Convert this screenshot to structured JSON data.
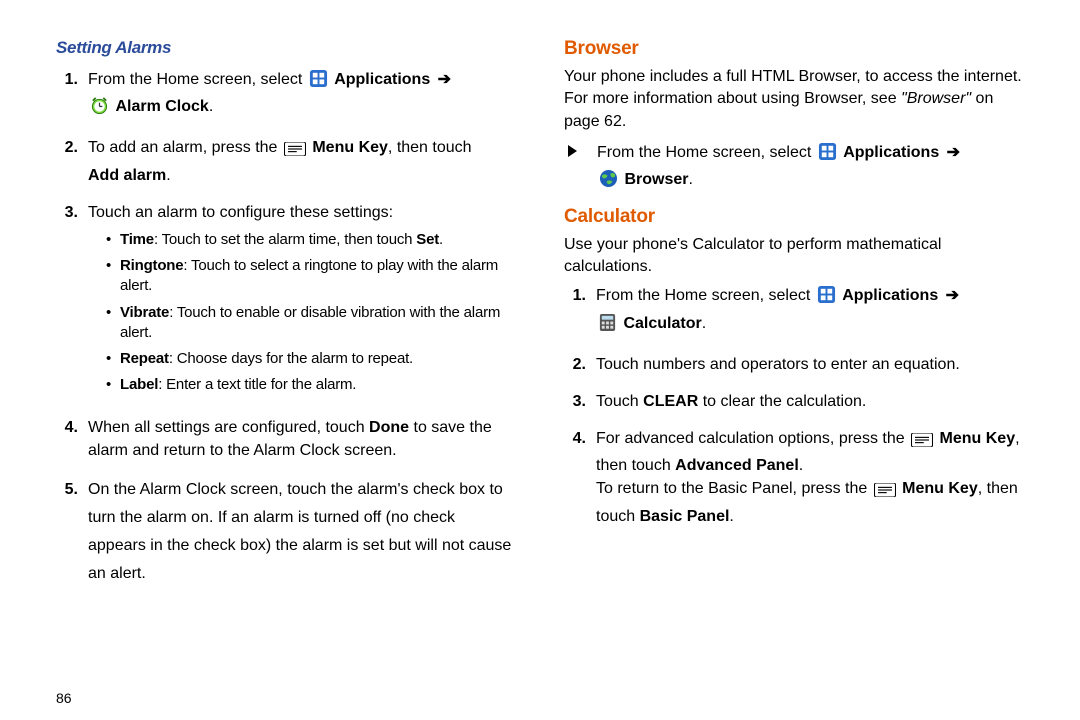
{
  "pageNumber": "86",
  "left": {
    "heading": "Setting Alarms",
    "items": [
      {
        "n": "1.",
        "pre": "From the Home screen, select ",
        "app": "Applications",
        "arrow": " ➔",
        "line2": " Alarm Clock",
        "period": "."
      },
      {
        "n": "2.",
        "pre": "To add an alarm, press the ",
        "menu": "Menu Key",
        "mid": ", then touch ",
        "bold": "Add alarm",
        "period": "."
      },
      {
        "n": "3.",
        "text": "Touch an alarm to configure these settings:"
      },
      {
        "n": "4.",
        "pre": "When all settings are configured, touch ",
        "bold": "Done",
        "post": " to save the alarm and return to the Alarm Clock screen."
      },
      {
        "n": "5.",
        "text": "On the Alarm Clock screen, touch the alarm's check box to turn the alarm on. If an alarm is turned off (no check appears in the check box) the alarm is set but will not cause an alert."
      }
    ],
    "bullets": [
      {
        "b": "Time",
        "t": ": Touch to set the alarm time, then touch ",
        "b2": "Set",
        "p": "."
      },
      {
        "b": "Ringtone",
        "t": ": Touch to select a ringtone to play with the alarm alert."
      },
      {
        "b": "Vibrate",
        "t": ": Touch to enable or disable vibration with the alarm alert."
      },
      {
        "b": "Repeat",
        "t": ": Choose days for the alarm to repeat."
      },
      {
        "b": "Label",
        "t": ": Enter a text title for the alarm."
      }
    ]
  },
  "right": {
    "browser": {
      "heading": "Browser",
      "intro_a": "Your phone includes a full HTML Browser, to access the internet. For more information about using Browser, see ",
      "intro_ref": "\"Browser\"",
      "intro_b": " on page 62.",
      "step_pre": "From the Home screen, select ",
      "step_app": "Applications",
      "step_arrow": " ➔",
      "step_target": " Browser",
      "step_period": "."
    },
    "calc": {
      "heading": "Calculator",
      "intro": "Use your phone's Calculator to perform mathematical calculations.",
      "items": [
        {
          "n": "1.",
          "pre": "From the Home screen, select ",
          "app": "Applications",
          "arrow": " ➔",
          "line2": " Calculator",
          "period": "."
        },
        {
          "n": "2.",
          "text": "Touch numbers and operators to enter an equation."
        },
        {
          "n": "3.",
          "pre": "Touch ",
          "bold": "CLEAR",
          "post": " to clear the calculation."
        },
        {
          "n": "4.",
          "pre": "For advanced calculation options, press the ",
          "menu": "Menu Key",
          "mid": ", then touch ",
          "bold2": "Advanced Panel",
          "period": ".",
          "extra_a": "To return to the Basic Panel, press the ",
          "extra_menu": "Menu Key",
          "extra_b": ", then touch ",
          "extra_bold": "Basic Panel",
          "extra_p": "."
        }
      ]
    }
  }
}
